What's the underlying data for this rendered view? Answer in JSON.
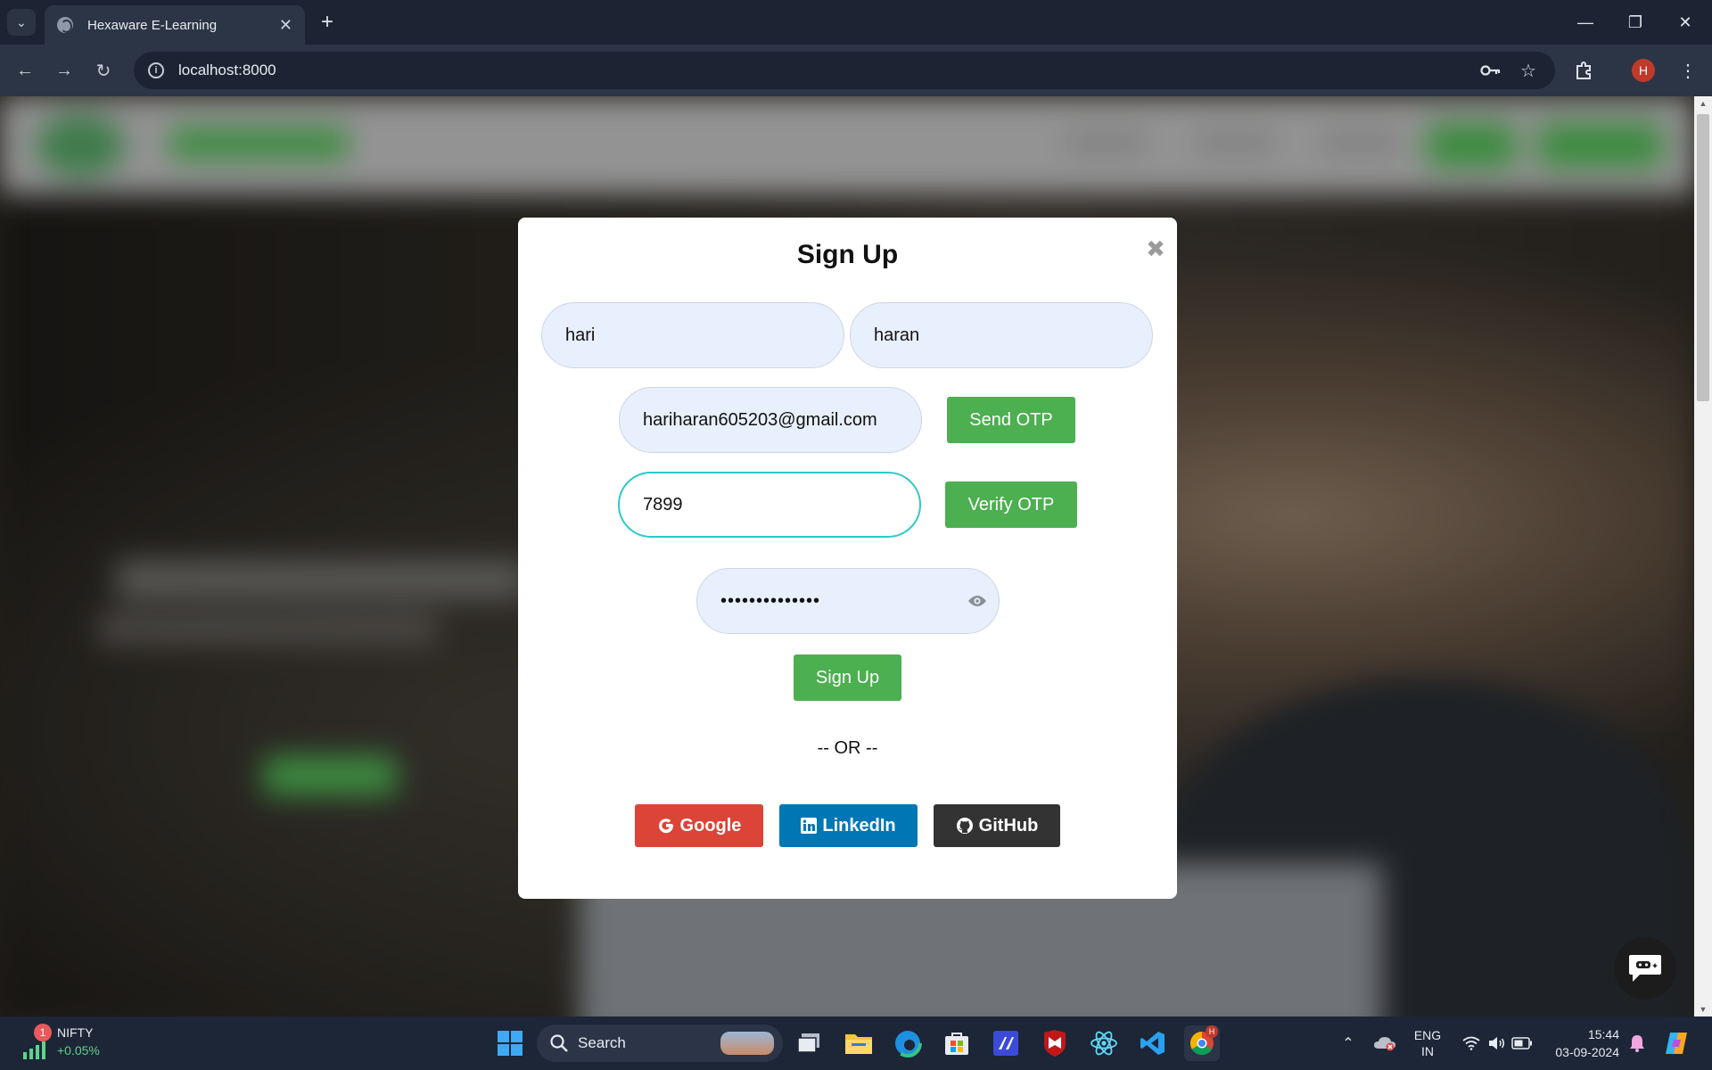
{
  "browser": {
    "tab_title": "Hexaware E-Learning",
    "url": "localhost:8000",
    "profile_initial": "H"
  },
  "modal": {
    "title": "Sign Up",
    "first_name": "hari",
    "last_name": "haran",
    "email": "hariharan605203@gmail.com",
    "send_otp_label": "Send OTP",
    "otp": "7899",
    "verify_otp_label": "Verify OTP",
    "password_masked": "••••••••••••••",
    "signup_label": "Sign Up",
    "or_text": "-- OR --",
    "google_label": "Google",
    "linkedin_label": "LinkedIn",
    "github_label": "GitHub"
  },
  "colors": {
    "accent_green": "#4caf50",
    "google_red": "#db4437",
    "linkedin_blue": "#0077b5",
    "github_dark": "#333333",
    "input_bg": "#e8effd",
    "focus_border": "#2dc9c9"
  },
  "taskbar": {
    "ticker_name": "NIFTY",
    "ticker_change": "+0.05%",
    "notification_count": "1",
    "search_label": "Search",
    "lang_line1": "ENG",
    "lang_line2": "IN",
    "time": "15:44",
    "date": "03-09-2024"
  }
}
